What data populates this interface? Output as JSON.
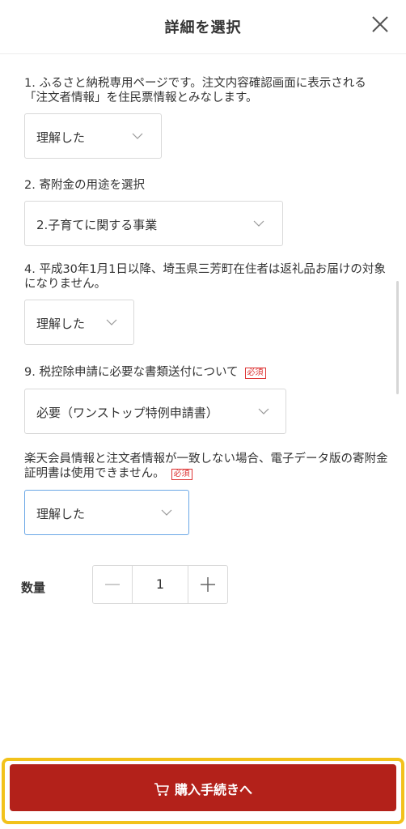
{
  "header": {
    "title": "詳細を選択",
    "close_icon": "close-icon"
  },
  "questions": [
    {
      "label": "1. ふるさと納税専用ページです。注文内容確認画面に表示される「注文者情報」を住民票情報とみなします。",
      "value": "理解した",
      "required": false
    },
    {
      "label": "2. 寄附金の用途を選択",
      "value": "2.子育てに関する事業",
      "required": false
    },
    {
      "label": "4. 平成30年1月1日以降、埼玉県三芳町在住者は返礼品お届けの対象になりません。",
      "value": "理解した",
      "required": false
    },
    {
      "label": "9. 税控除申請に必要な書類送付について",
      "value": "必要（ワンストップ特例申請書）",
      "required": true,
      "required_label": "必須"
    },
    {
      "label": "楽天会員情報と注文者情報が一致しない場合、電子データ版の寄附金証明書は使用できません。",
      "value": "理解した",
      "required": true,
      "required_label": "必須"
    }
  ],
  "quantity": {
    "label": "数量",
    "value": "1",
    "minus_icon": "minus-icon",
    "plus_icon": "plus-icon"
  },
  "footer": {
    "buy_label": "購入手続きへ",
    "buy_icon": "cart-icon"
  },
  "colors": {
    "primary": "#b3211a",
    "highlight_outline": "#f2c21b",
    "required": "#dd3333",
    "active_border": "#6aa7e6"
  }
}
